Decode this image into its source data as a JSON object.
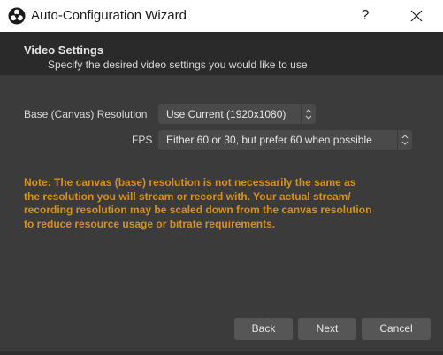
{
  "window": {
    "title": "Auto-Configuration Wizard",
    "help_label": "?",
    "close_icon": "close-icon",
    "app_icon": "obs-logo-icon"
  },
  "page": {
    "title": "Video Settings",
    "subtitle": "Specify the desired video settings you would like to use"
  },
  "fields": {
    "resolution": {
      "label": "Base (Canvas) Resolution",
      "value": "Use Current (1920x1080)"
    },
    "fps": {
      "label": "FPS",
      "value": "Either 60 or 30, but prefer 60 when possible"
    }
  },
  "note": {
    "lines": [
      "Note: The canvas (base) resolution is not necessarily the same as",
      "the resolution you will stream or record with.  Your actual stream/",
      "recording resolution may be scaled down from the canvas resolution",
      "to reduce resource usage or bitrate requirements."
    ],
    "color": "#d4911f"
  },
  "buttons": {
    "back": "Back",
    "next": "Next",
    "cancel": "Cancel"
  },
  "colors": {
    "background": "#3b3b3b",
    "header_background": "#2a2a2a",
    "button_background": "#565656"
  }
}
